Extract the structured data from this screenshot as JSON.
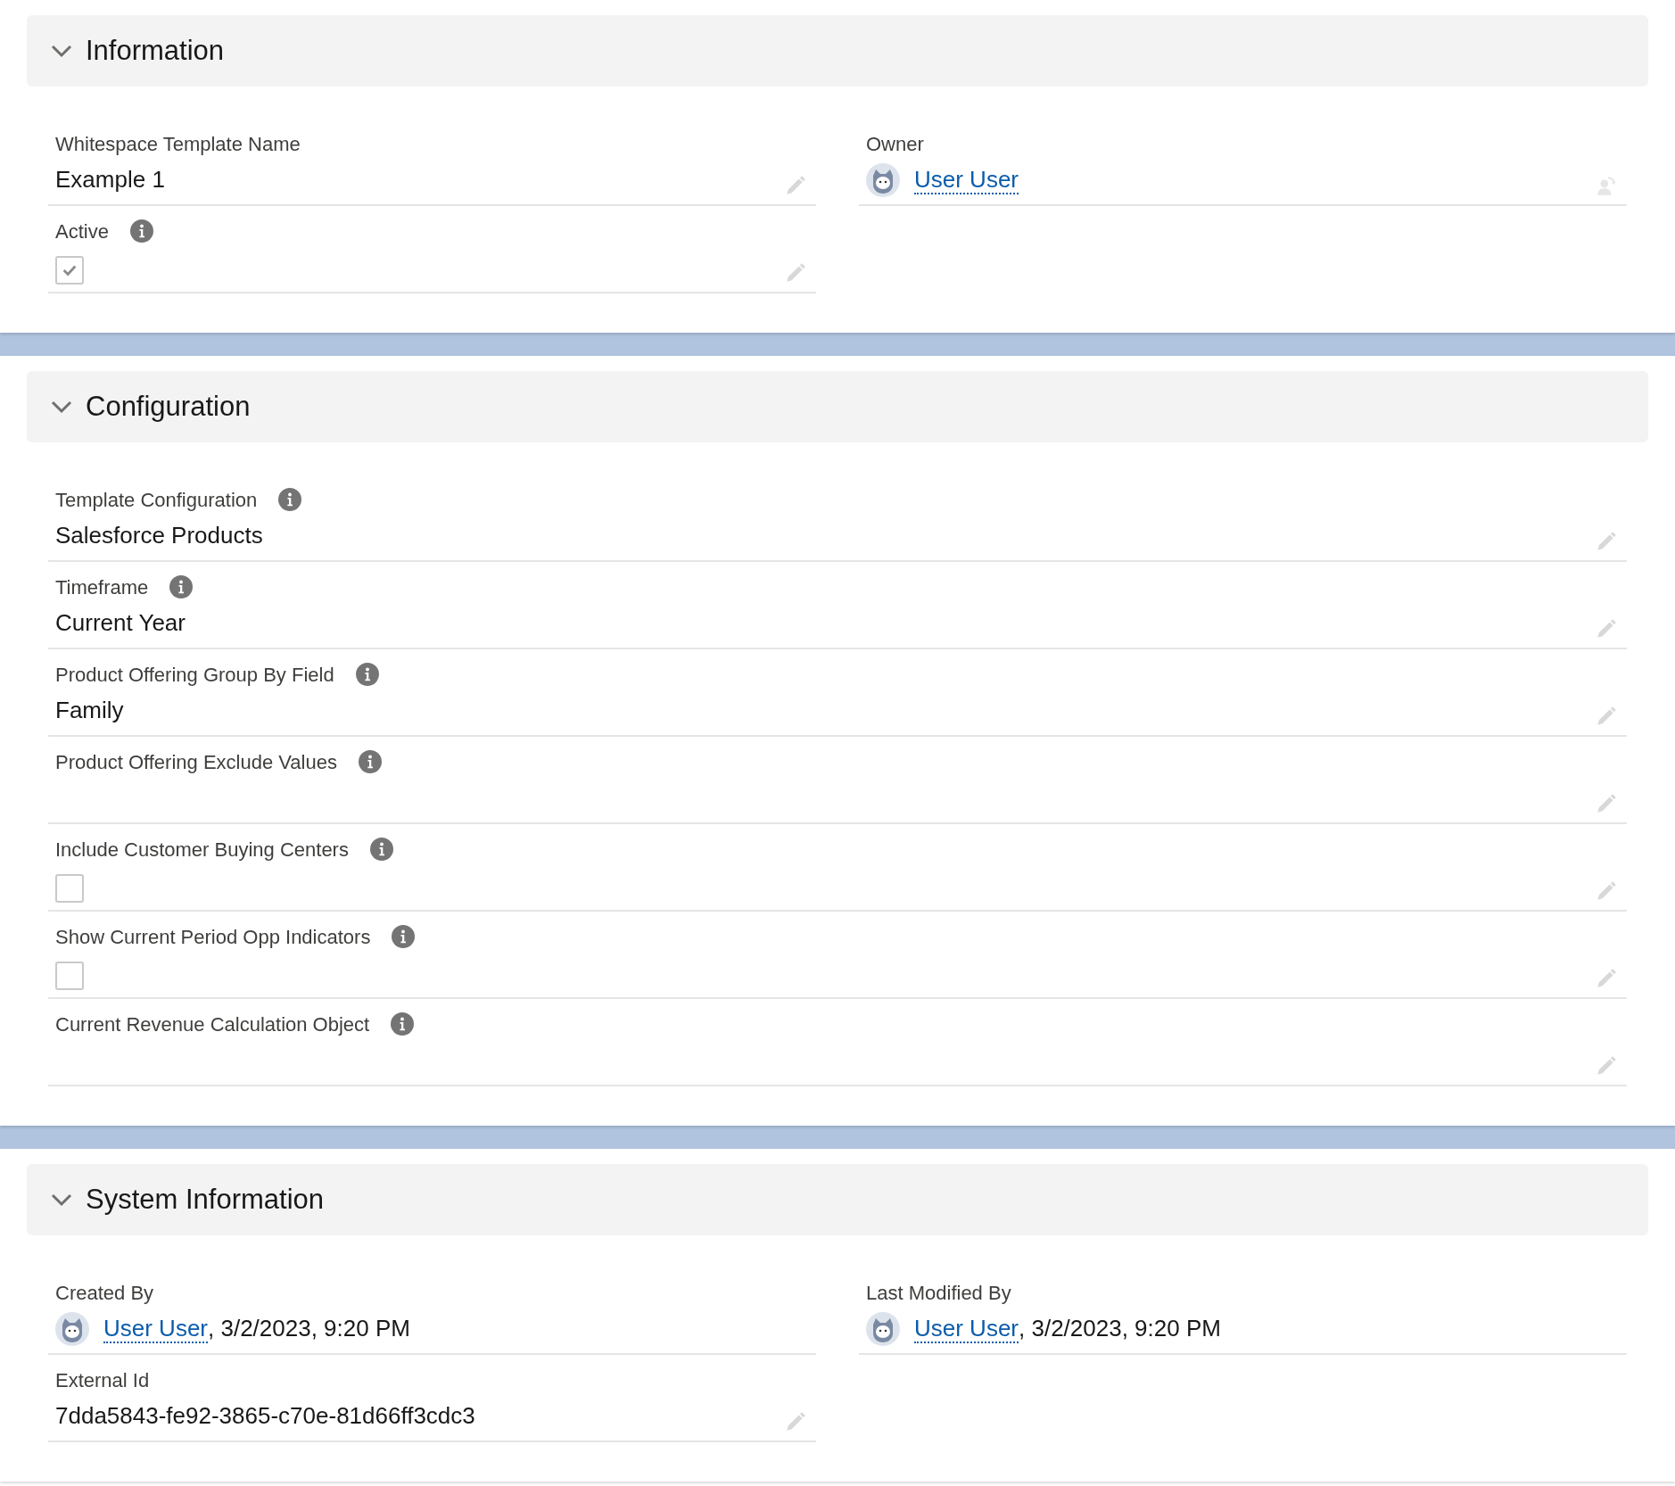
{
  "sections": [
    {
      "title": "Information",
      "expanded": true,
      "kind": "two_column",
      "fields": [
        {
          "kind": "text",
          "label": "Whitespace Template Name",
          "info": false,
          "value": "Example 1",
          "editable": true
        },
        {
          "kind": "user",
          "label": "Owner",
          "info": false,
          "user": "User User",
          "owner_changeable": true
        },
        {
          "kind": "checkbox",
          "label": "Active",
          "info": true,
          "checked": true,
          "editable": true
        }
      ]
    },
    {
      "title": "Configuration",
      "expanded": true,
      "kind": "single_column",
      "fields": [
        {
          "kind": "text",
          "label": "Template Configuration",
          "info": true,
          "value": "Salesforce Products",
          "editable": true
        },
        {
          "kind": "text",
          "label": "Timeframe",
          "info": true,
          "value": "Current Year",
          "editable": true
        },
        {
          "kind": "text",
          "label": "Product Offering Group By Field",
          "info": true,
          "value": "Family",
          "editable": true
        },
        {
          "kind": "text",
          "label": "Product Offering Exclude Values",
          "info": true,
          "editable": true
        },
        {
          "kind": "checkbox",
          "label": "Include Customer Buying Centers",
          "info": true,
          "checked": false,
          "editable": true
        },
        {
          "kind": "checkbox",
          "label": "Show Current Period Opp Indicators",
          "info": true,
          "checked": false,
          "editable": true
        },
        {
          "kind": "text",
          "label": "Current Revenue Calculation Object",
          "info": true,
          "editable": true
        }
      ]
    },
    {
      "title": "System Information",
      "expanded": true,
      "kind": "two_column",
      "fields": [
        {
          "kind": "user",
          "label": "Created By",
          "info": false,
          "user": "User User",
          "date": ", 3/2/2023, 9:20 PM"
        },
        {
          "kind": "user",
          "label": "Last Modified By",
          "info": false,
          "user": "User User",
          "date": ", 3/2/2023, 9:20 PM"
        },
        {
          "kind": "text",
          "label": "External Id",
          "info": false,
          "value": "7dda5843-fe92-3865-c70e-81d66ff3cdc3",
          "editable": true
        }
      ]
    }
  ]
}
